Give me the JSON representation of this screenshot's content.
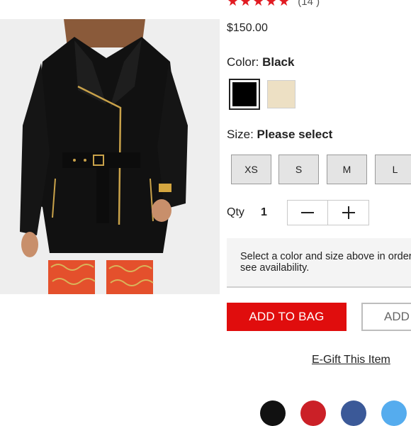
{
  "product": {
    "review_count": "(14 )",
    "price": "$150.00"
  },
  "color": {
    "label": "Color: ",
    "selected": "Black",
    "swatches": [
      {
        "name": "black",
        "hex": "#000000"
      },
      {
        "name": "cream",
        "hex": "#ede0c4"
      }
    ]
  },
  "size": {
    "label": "Size: ",
    "selected": "Please select",
    "options": [
      "XS",
      "S",
      "M",
      "L"
    ]
  },
  "quantity": {
    "label": "Qty",
    "value": "1",
    "decrement_icon": "minus-icon",
    "increment_icon": "plus-icon"
  },
  "notice": {
    "text": "Select a color and size above in order to see availability."
  },
  "actions": {
    "add_to_bag": "ADD TO BAG",
    "add_secondary": "ADD",
    "egift": "E-Gift This Item"
  },
  "social": [
    "email-icon",
    "pinterest-icon",
    "facebook-icon",
    "twitter-icon"
  ],
  "colors": {
    "accent_red": "#e00d0d",
    "star_red": "#e11b22"
  }
}
